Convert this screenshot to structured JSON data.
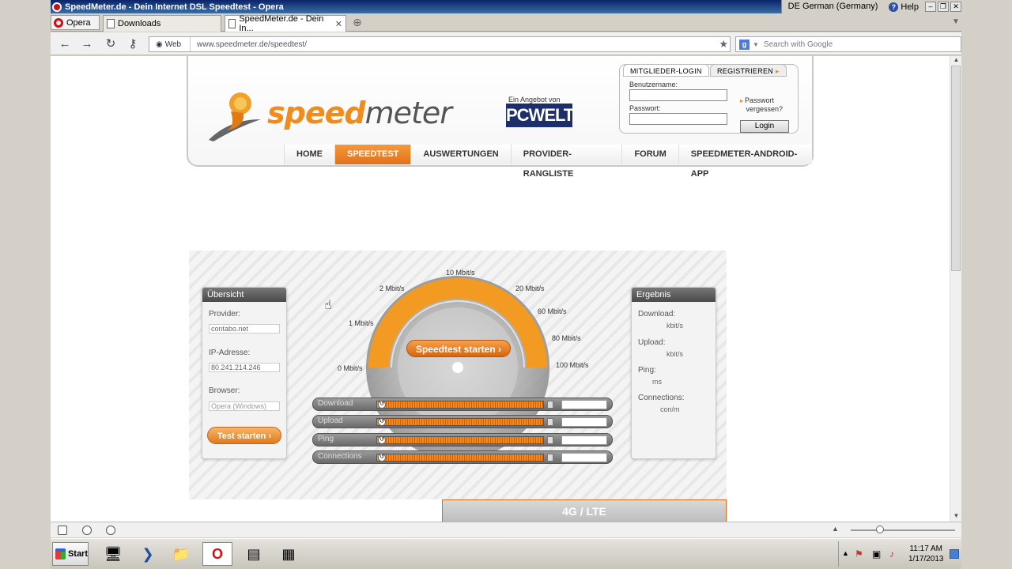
{
  "window": {
    "title": "SpeedMeter.de - Dein Internet DSL Speedtest - Opera",
    "language": "DE German (Germany)",
    "help": "Help"
  },
  "tabs": {
    "opera_menu": "Opera",
    "items": [
      {
        "label": "Downloads"
      },
      {
        "label": "SpeedMeter.de - Dein In..."
      }
    ]
  },
  "address": {
    "web_label": "Web",
    "url": "www.speedmeter.de/speedtest/",
    "search_placeholder": "Search with Google"
  },
  "header": {
    "logo_part1": "speed",
    "logo_part2": "meter",
    "angebot": "Ein Angebot von",
    "pcwelt": "PCWELT",
    "login": {
      "tab_login": "MITGLIEDER-LOGIN",
      "tab_register": "REGISTRIEREN",
      "username_label": "Benutzername:",
      "password_label": "Passwort:",
      "forgot_line1": "Passwort",
      "forgot_line2": "vergessen?",
      "login_button": "Login"
    },
    "menu": [
      "HOME",
      "SPEEDTEST",
      "AUSWERTUNGEN",
      "PROVIDER-RANGLISTE",
      "FORUM",
      "SPEEDMETER-ANDROID-APP"
    ],
    "active_menu": "SPEEDTEST"
  },
  "overview": {
    "title": "Übersicht",
    "provider_label": "Provider:",
    "provider_value": "contabo.net",
    "ip_label": "IP-Adresse:",
    "ip_value": "80.241.214.246",
    "browser_label": "Browser:",
    "browser_value": "Opera (Windows)",
    "test_button": "Test starten"
  },
  "gauge": {
    "labels": [
      "0 Mbit/s",
      "1 Mbit/s",
      "2 Mbit/s",
      "10 Mbit/s",
      "20 Mbit/s",
      "60 Mbit/s",
      "80 Mbit/s",
      "100 Mbit/s"
    ],
    "start_button": "Speedtest starten"
  },
  "bars": [
    "Download",
    "Upload",
    "Ping",
    "Connections"
  ],
  "result": {
    "title": "Ergebnis",
    "download_label": "Download:",
    "download_unit": "kbit/s",
    "upload_label": "Upload:",
    "upload_unit": "kbit/s",
    "ping_label": "Ping:",
    "ping_unit": "ms",
    "connections_label": "Connections:",
    "connections_unit": "con/m"
  },
  "banner": "4G / LTE",
  "taskbar": {
    "start": "Start",
    "time": "11:17 AM",
    "date": "1/17/2013"
  },
  "colors": {
    "accent": "#f08c1e",
    "title_bar": "#0a246a",
    "pcwelt": "#1d2f6b"
  }
}
